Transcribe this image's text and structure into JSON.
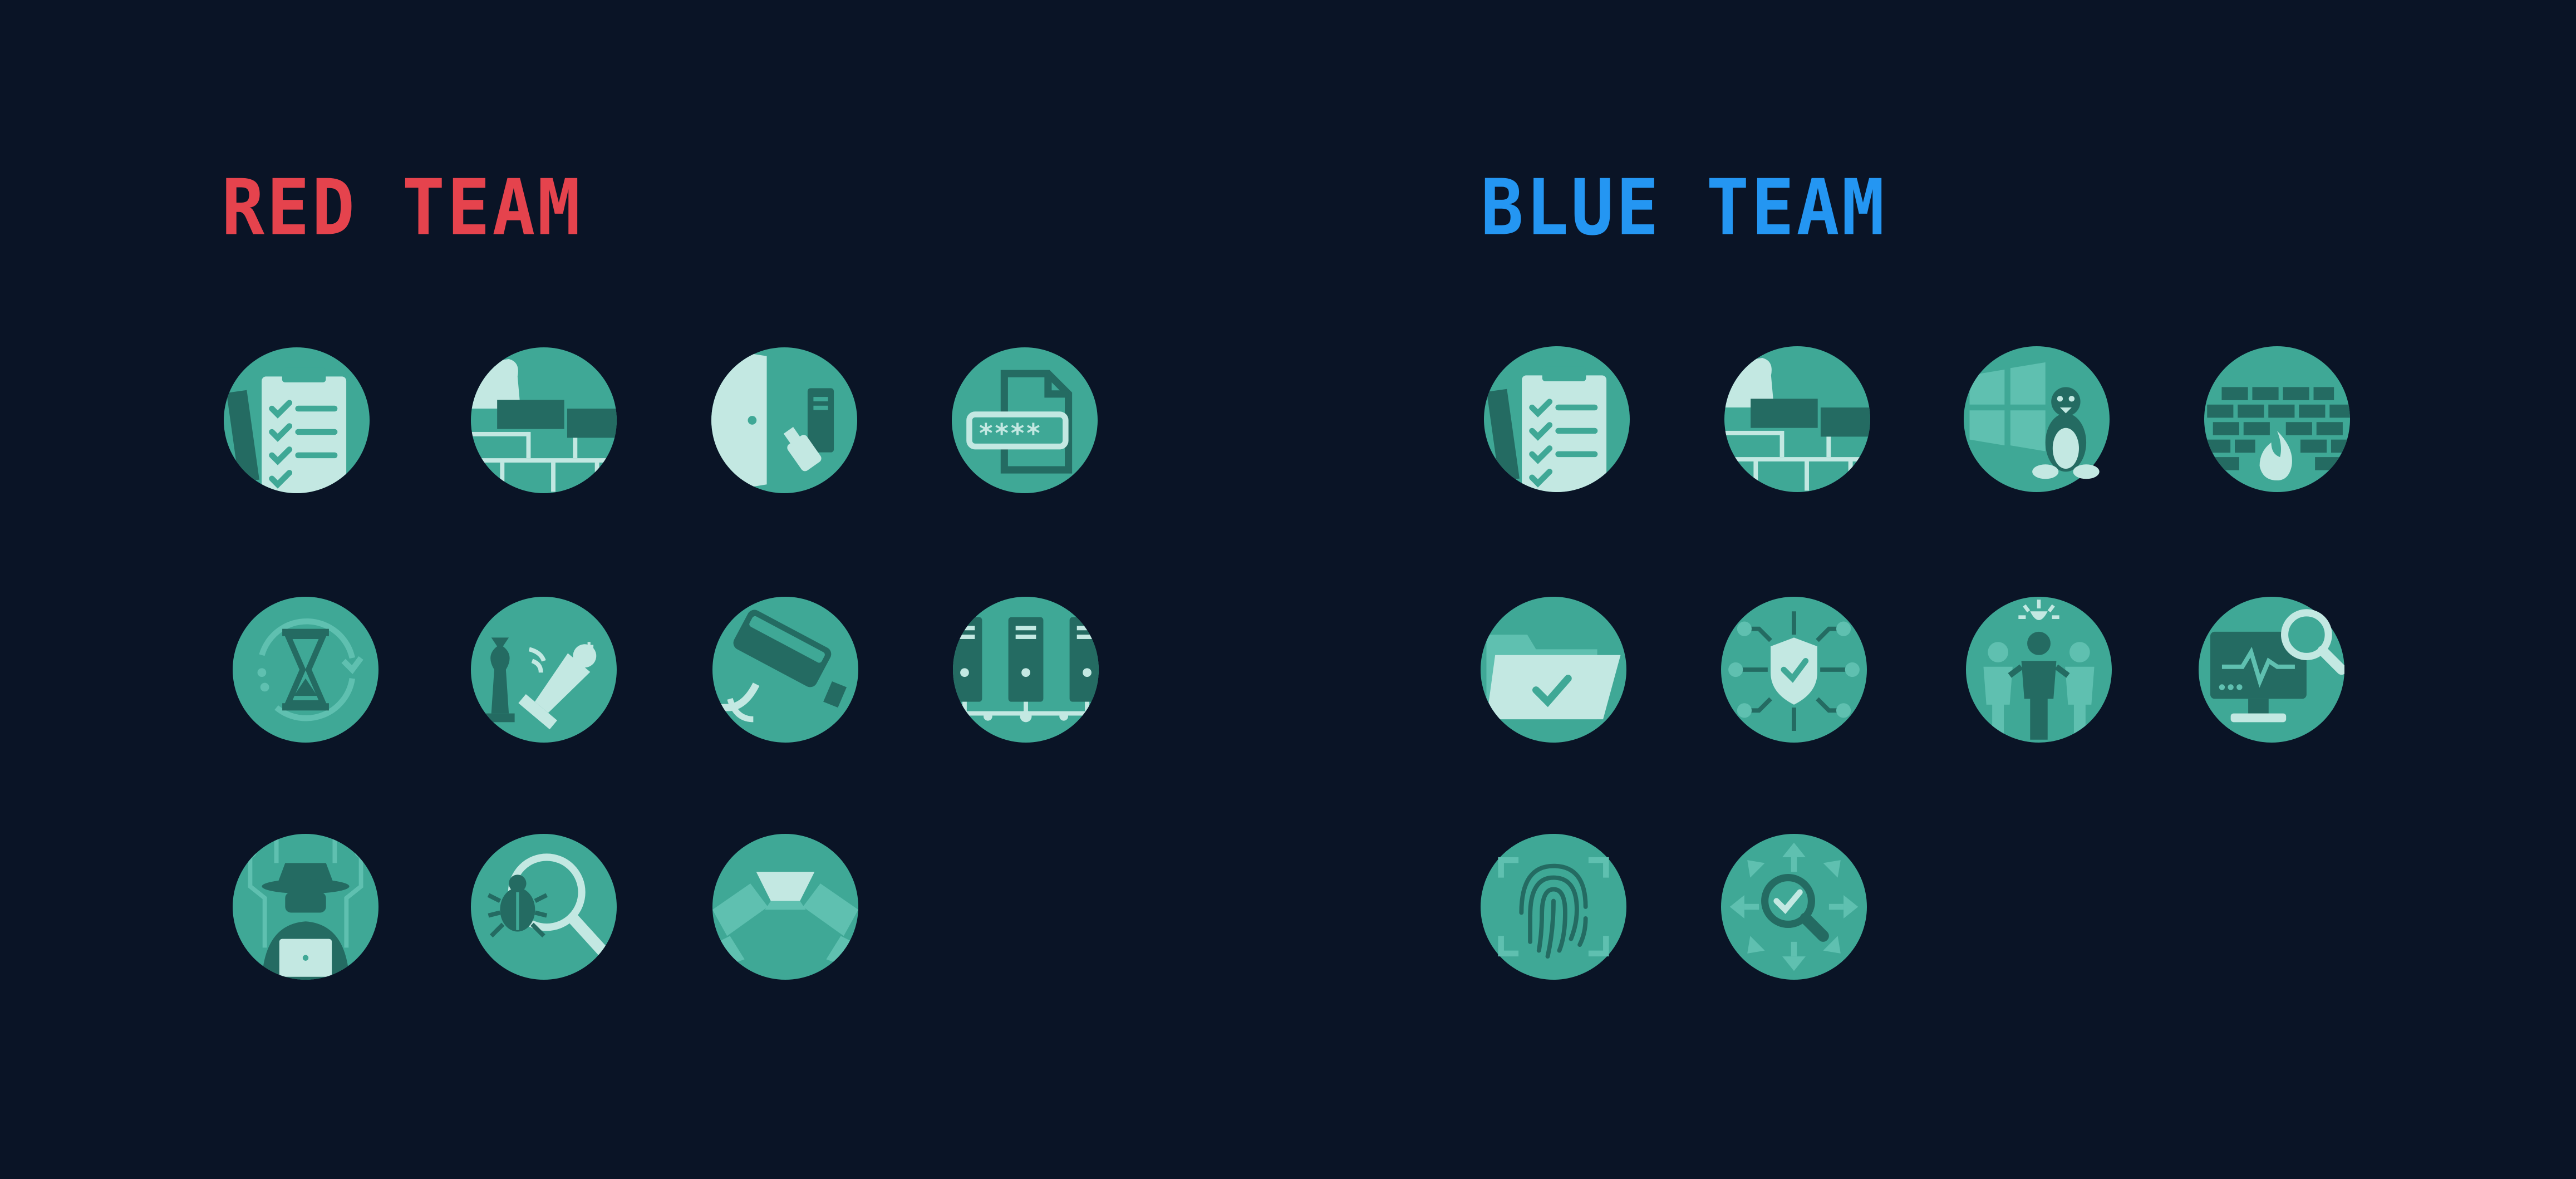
{
  "colors": {
    "background": "#0a1426",
    "red_team": "#e5434d",
    "blue_team": "#2496f2",
    "icon_base": "#3fa896",
    "icon_dark": "#246b62",
    "icon_light": "#c3e8e2",
    "icon_mid": "#5fc0b0"
  },
  "red_team": {
    "title": "RED TEAM",
    "icons": [
      "checklist-clipboard-icon",
      "brick-wall-hand-icon",
      "door-usb-drive-icon",
      "password-file-icon",
      "hourglass-cycle-icon",
      "chess-pieces-icon",
      "security-camera-icon",
      "server-network-icon",
      "hacker-laptop-icon",
      "bug-magnifier-icon",
      "arched-bridge-icon"
    ]
  },
  "blue_team": {
    "title": "BLUE TEAM",
    "icons": [
      "checklist-clipboard-icon",
      "brick-wall-hand-icon",
      "windows-linux-icon",
      "firewall-icon",
      "folder-check-icon",
      "shield-network-icon",
      "team-people-icon",
      "monitor-search-icon",
      "fingerprint-scan-icon",
      "search-arrows-icon"
    ]
  }
}
